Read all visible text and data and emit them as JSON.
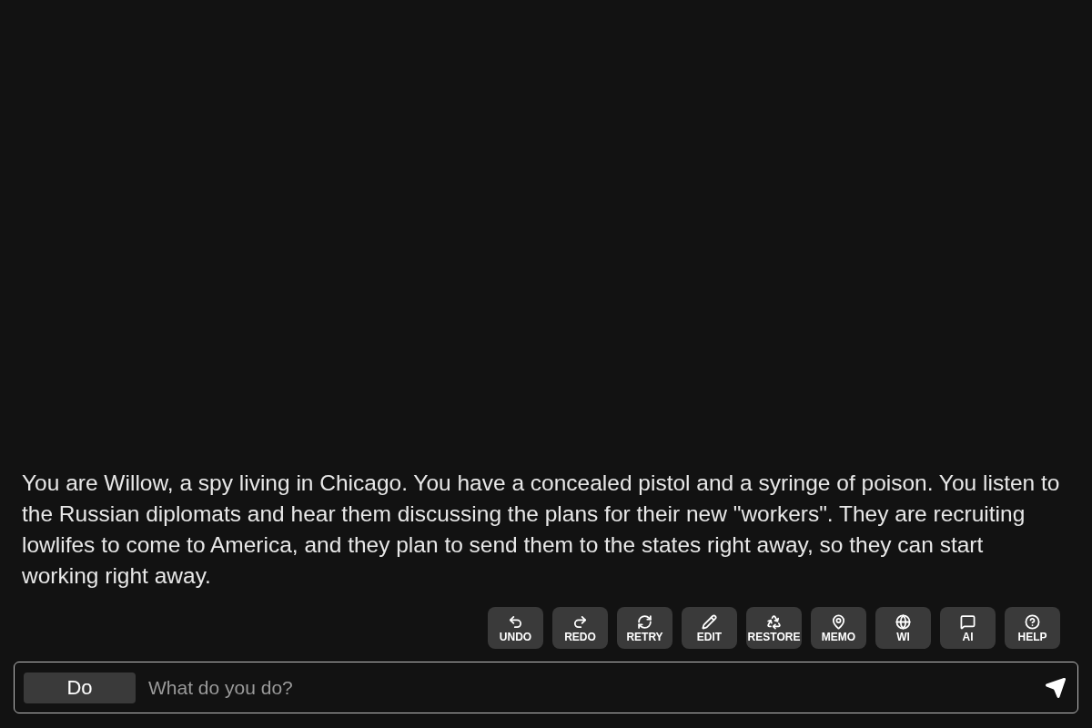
{
  "story": {
    "text": "You are Willow, a spy living in Chicago. You have a concealed pistol and a syringe of poison. You listen to the Russian diplomats and hear them discussing the plans for their new \"workers\". They are recruiting lowlifes to come to America, and they plan to send them to the states right away, so they can start working right away."
  },
  "toolbar": [
    {
      "label": "UNDO",
      "kind": "undo"
    },
    {
      "label": "REDO",
      "kind": "redo"
    },
    {
      "label": "RETRY",
      "kind": "retry"
    },
    {
      "label": "EDIT",
      "kind": "edit"
    },
    {
      "label": "RESTORE",
      "kind": "restore"
    },
    {
      "label": "MEMO",
      "kind": "memo"
    },
    {
      "label": "WI",
      "kind": "wi"
    },
    {
      "label": "AI",
      "kind": "ai"
    },
    {
      "label": "HELP",
      "kind": "help"
    }
  ],
  "input": {
    "mode": "Do",
    "placeholder": "What do you do?"
  }
}
